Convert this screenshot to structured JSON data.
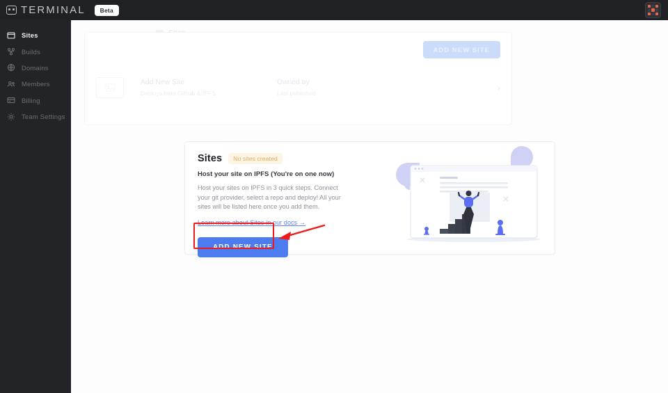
{
  "header": {
    "logo_text": "TERMINAL",
    "logo_icon": "robot-face-icon",
    "beta_label": "Beta",
    "avatar_icon": "user-identicon-avatar"
  },
  "sidebar": {
    "items": [
      {
        "label": "Sites",
        "icon": "window-sites-icon",
        "active": true
      },
      {
        "label": "Builds",
        "icon": "builds-branch-icon",
        "active": false
      },
      {
        "label": "Domains",
        "icon": "globe-icon",
        "active": false
      },
      {
        "label": "Members",
        "icon": "members-group-icon",
        "active": false
      },
      {
        "label": "Billing",
        "icon": "credit-card-icon",
        "active": false
      },
      {
        "label": "Team Settings",
        "icon": "gear-icon",
        "active": false
      }
    ]
  },
  "breadcrumb": {
    "icon": "window-sites-icon",
    "label": "Sites"
  },
  "ghost_card": {
    "add_button_label": "ADD NEW SITE",
    "thumb_icon": "image-placeholder-icon",
    "row": {
      "title": "Add New Site",
      "subtitle": "Deploys from Github & IPFS",
      "owned_by": "Owned by",
      "last_published": "Last published",
      "chevron_icon": "chevron-right-icon"
    }
  },
  "empty_state": {
    "title": "Sites",
    "badge": "No sites created",
    "subtitle": "Host your site on IPFS (You're on one now)",
    "body": "Host your sites on IPFS in 3 quick steps. Connect your git provider, select a repo and deploy! All your sites will be listed here once you add them.",
    "link": "Learn more about Sites in our docs →",
    "cta_label": "ADD NEW SITE",
    "illustration": "browser-window-person-on-stairs-illustration"
  },
  "annotations": {
    "highlight_box": "red-rectangle-around-add-new-site-button",
    "arrow": "red-arrow-pointing-left-at-add-new-site-button"
  },
  "colors": {
    "topbar_bg": "#1f2124",
    "sidebar_bg": "#222428",
    "main_bg": "#fdfdfe",
    "accent_blue": "#4d7cf0",
    "ghost_blue": "#cbdcfa",
    "badge_bg": "#fdf5e3",
    "badge_text": "#e0a962",
    "annotation_red": "#f01a1a",
    "illustration_purple": "#c5c8f2",
    "avatar_accent": "#e8674f"
  }
}
